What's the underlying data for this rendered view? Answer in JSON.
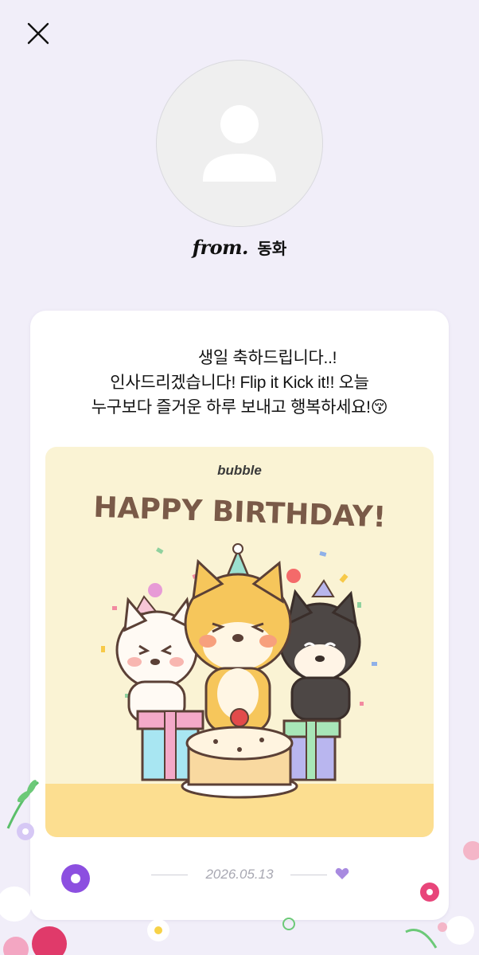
{
  "header": {
    "close_icon": "close-icon"
  },
  "profile": {
    "from_prefix": "from.",
    "from_name": "동화",
    "avatar_icon": "user-silhouette-icon"
  },
  "message": {
    "lines": [
      "생일 축하드립니다..!",
      "인사드리겠습니다! Flip it Kick it!! 오늘",
      "누구보다 즐거운 하루 보내고 행복하세요!😚"
    ]
  },
  "card_image": {
    "brand": "bubble",
    "headline": "HAPPY BIRTHDAY!"
  },
  "footer": {
    "date": "2026.05.13",
    "heart_icon": "heart-icon"
  },
  "colors": {
    "background": "#f1eef9",
    "card": "#ffffff",
    "image_bg": "#faf3d4",
    "headline": "#7a5a48",
    "heart": "#a88ae0"
  }
}
